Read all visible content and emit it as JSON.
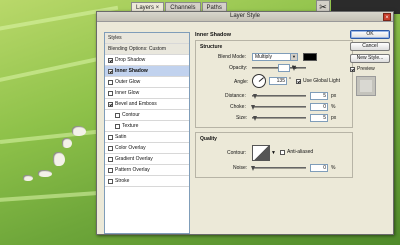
{
  "palette": {
    "tabs": [
      "Layers ×",
      "Channels",
      "Paths"
    ]
  },
  "dialog": {
    "title": "Layer Style",
    "close_label": "×",
    "styles": [
      {
        "label": "Styles",
        "type": "header"
      },
      {
        "label": "Blending Options: Custom",
        "type": "header"
      },
      {
        "label": "Drop Shadow",
        "checked": true
      },
      {
        "label": "Inner Shadow",
        "checked": true,
        "selected": true
      },
      {
        "label": "Outer Glow",
        "checked": false
      },
      {
        "label": "Inner Glow",
        "checked": false
      },
      {
        "label": "Bevel and Emboss",
        "checked": true
      },
      {
        "label": "Contour",
        "checked": false,
        "sub": true
      },
      {
        "label": "Texture",
        "checked": false,
        "sub": true
      },
      {
        "label": "Satin",
        "checked": false
      },
      {
        "label": "Color Overlay",
        "checked": false
      },
      {
        "label": "Gradient Overlay",
        "checked": false
      },
      {
        "label": "Pattern Overlay",
        "checked": false
      },
      {
        "label": "Stroke",
        "checked": false
      }
    ],
    "panel": {
      "group_title": "Inner Shadow",
      "structure_legend": "Structure",
      "blend_mode_label": "Blend Mode:",
      "blend_mode_value": "Multiply",
      "opacity_label": "Opacity:",
      "opacity_value": "",
      "opacity_unit": "%",
      "angle_label": "Angle:",
      "angle_value": "135",
      "angle_unit": "°",
      "global_light_label": "Use Global Light",
      "global_light_checked": true,
      "distance_label": "Distance:",
      "distance_value": "5",
      "choke_label": "Choke:",
      "choke_value": "0",
      "size_label": "Size:",
      "size_value": "5",
      "px_unit": "px",
      "pct_unit": "%",
      "quality_legend": "Quality",
      "contour_label": "Contour:",
      "anti_aliased_label": "Anti-aliased",
      "noise_label": "Noise:",
      "noise_value": "0"
    },
    "buttons": {
      "ok": "OK",
      "cancel": "Cancel",
      "new_style": "New Style...",
      "preview_label": "Preview",
      "preview_checked": true
    }
  },
  "colors": {
    "shadow_color": "#000000",
    "leaf_green": "#8fc24a"
  }
}
